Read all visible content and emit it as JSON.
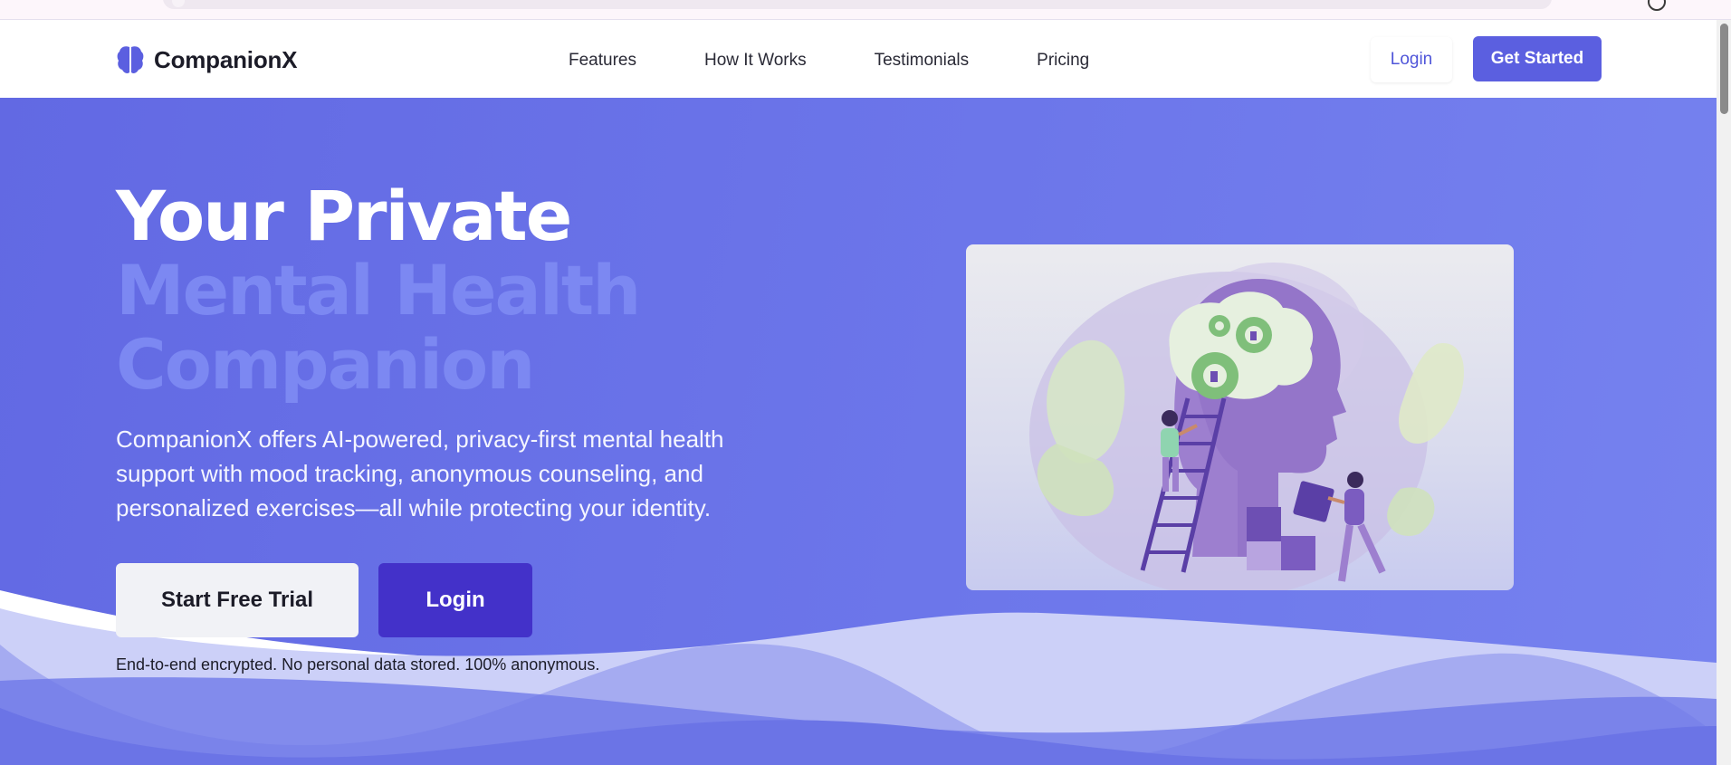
{
  "brand": {
    "name": "CompanionX",
    "logo_icon": "brain-icon",
    "accent": "#5b5fe0"
  },
  "nav": {
    "links": [
      "Features",
      "How It Works",
      "Testimonials",
      "Pricing"
    ],
    "login_label": "Login",
    "cta_label": "Get Started"
  },
  "hero": {
    "title_line1": "Your Private",
    "title_line2": "Mental Health",
    "title_line3": "Companion",
    "description": "CompanionX offers AI-powered, privacy-first mental health support with mood tracking, anonymous counseling, and personalized exercises—all while protecting your identity.",
    "primary_button": "Start Free Trial",
    "secondary_button": "Login",
    "trust_note": "End-to-end encrypted. No personal data stored. 100% anonymous.",
    "illustration": "mental-health-head-illustration",
    "background_start": "#6269e3",
    "background_end": "#7682ef"
  }
}
